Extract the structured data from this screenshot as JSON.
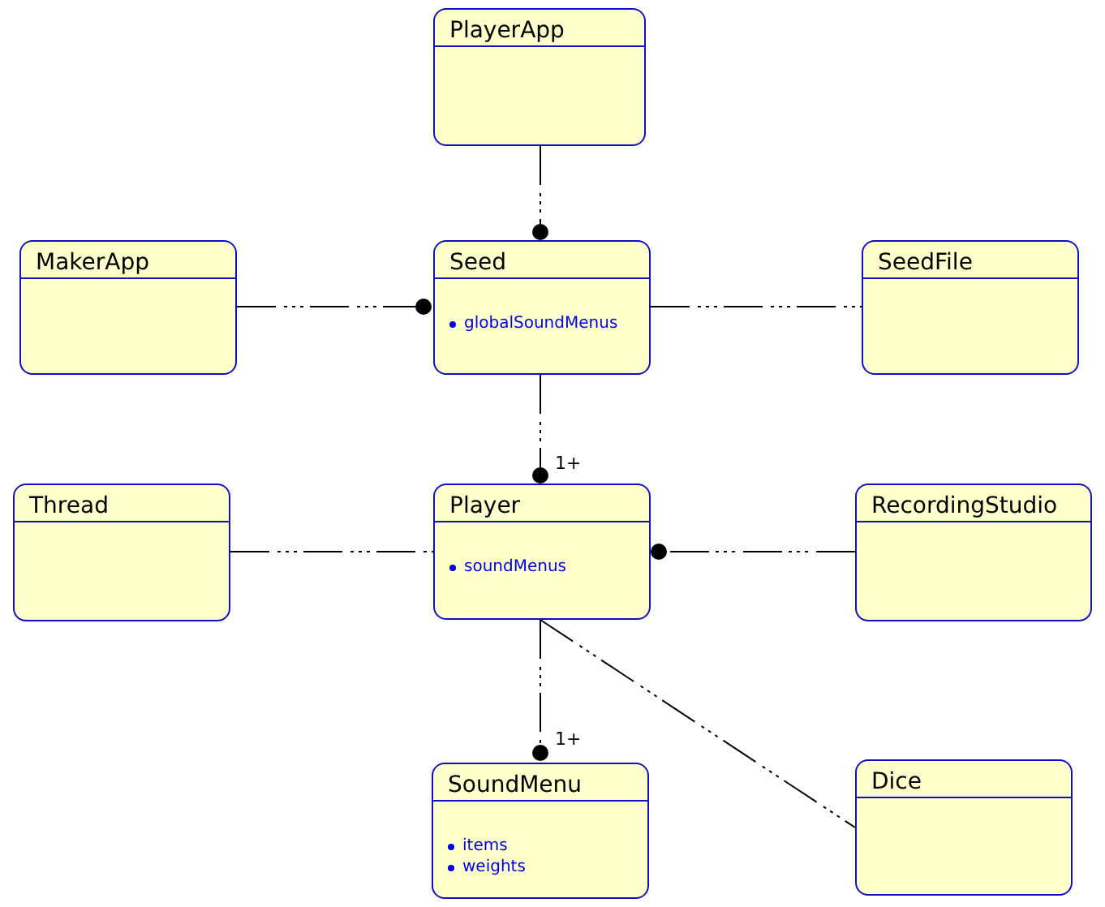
{
  "classes": [
    {
      "name": "PlayerApp"
    },
    {
      "name": "MakerApp"
    },
    {
      "name": "Seed",
      "attributes": [
        "globalSoundMenus"
      ]
    },
    {
      "name": "SeedFile"
    },
    {
      "name": "Thread"
    },
    {
      "name": "Player",
      "attributes": [
        "soundMenus"
      ]
    },
    {
      "name": "RecordingStudio"
    },
    {
      "name": "SoundMenu",
      "attributes": [
        "items",
        "weights"
      ]
    },
    {
      "name": "Dice"
    }
  ],
  "associations": [
    {
      "kind": "dot"
    },
    {
      "kind": "dot"
    },
    {
      "kind": "line"
    },
    {
      "kind": "dot",
      "multiplicity": "1+"
    },
    {
      "kind": "line"
    },
    {
      "kind": "dot"
    },
    {
      "kind": "dot",
      "multiplicity": "1+"
    },
    {
      "kind": "line"
    }
  ]
}
